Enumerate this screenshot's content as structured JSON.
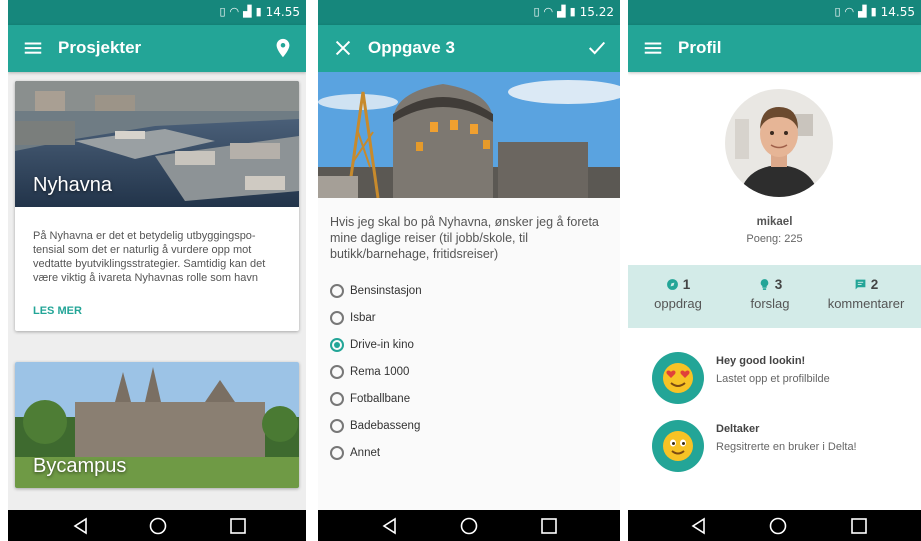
{
  "screens": {
    "projects": {
      "time": "14.55",
      "title": "Prosjekter",
      "cards": [
        {
          "title": "Nyhavna",
          "body": "På Nyhavna er det et betydelig utbyggingspo-tensial som det er naturlig å vurdere opp mot vedtatte byutviklingsstrategier. Samtidig kan det være viktig å ivareta Nyhavnas rolle som havn med plass til virksomheter som naturlig hører …",
          "link": "LES MER"
        },
        {
          "title": "Bycampus"
        }
      ]
    },
    "task": {
      "time": "15.22",
      "title": "Oppgave 3",
      "question": "Hvis jeg skal bo på Nyhavna, ønsker jeg å foreta mine daglige reiser (til jobb/skole, til butikk/barnehage, fritidsreiser)",
      "options": [
        "Bensinstasjon",
        "Isbar",
        "Drive-in kino",
        "Rema 1000",
        "Fotballbane",
        "Badebasseng",
        "Annet"
      ],
      "selected": "Drive-in kino"
    },
    "profile": {
      "time": "14.55",
      "title": "Profil",
      "username": "mikael",
      "points": "Poeng: 225",
      "stats": [
        {
          "count": "1",
          "label": "oppdrag",
          "icon": "compass-icon"
        },
        {
          "count": "3",
          "label": "forslag",
          "icon": "lightbulb-icon"
        },
        {
          "count": "2",
          "label": "kommentarer",
          "icon": "comment-icon"
        }
      ],
      "achievements": [
        {
          "title": "Hey good lookin!",
          "desc": "Lastet opp et profilbilde",
          "icon": "heart-eyes-emoji-icon"
        },
        {
          "title": "Deltaker",
          "desc": "Regsitrerte en bruker i Delta!",
          "icon": "smiley-emoji-icon"
        }
      ]
    }
  },
  "colors": {
    "primary": "#23a597",
    "status_bar": "#16877c",
    "stats_bg": "#d3ebe8"
  }
}
